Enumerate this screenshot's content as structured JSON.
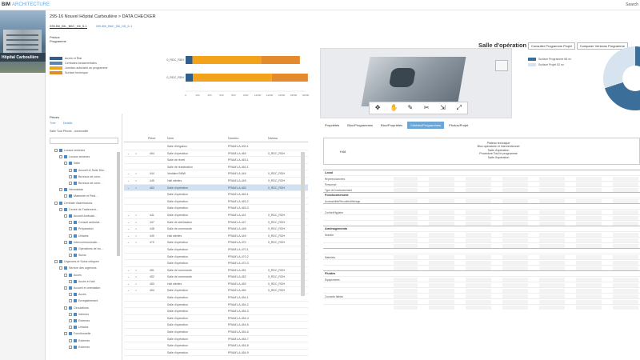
{
  "app": {
    "brand": "BIM",
    "brand_accent": "ARCHITECTURE",
    "search_label": "Search"
  },
  "sidebar": {
    "project_label": "Hôpital Carboulière"
  },
  "header": {
    "title": "295-16 Nouvel Hôpital Carboulière > DATA CHECKER",
    "tabs": [
      "295-B6_B6-_B6C_H6_5-1",
      "295-B6_B6C_B6_H6_5-1"
    ]
  },
  "filters": {
    "line1": "Préaux",
    "line2": "Programme"
  },
  "legend": [
    {
      "label": "Accès et Ëtat",
      "color": "#2f5f8a"
    },
    {
      "label": "Centrales fondamentales",
      "color": "#5a86b0"
    },
    {
      "label": "Jonction autorisée au programmé",
      "color": "#f3a21b"
    },
    {
      "label": "Surface technique",
      "color": "#e38b2c"
    }
  ],
  "bar_chart": {
    "categories": [
      "0_RDC_RDH",
      "0_RDC_RDH"
    ],
    "x_ticks": [
      "0",
      "200",
      "400",
      "600",
      "800",
      "1000",
      "12000",
      "14000",
      "16000",
      "18000",
      "20000"
    ]
  },
  "chart_data": {
    "type": "bar",
    "categories": [
      "0_RDC_RDH",
      "0_RDC_RDH"
    ],
    "series": [
      {
        "name": "Accès et Ëtat",
        "values": [
          1200,
          1300
        ]
      },
      {
        "name": "Jonction autorisée au programmé",
        "values": [
          12000,
          13800
        ]
      },
      {
        "name": "Surface technique",
        "values": [
          6800,
          6300
        ]
      }
    ],
    "xlim": [
      0,
      21000
    ],
    "orientation": "horizontal"
  },
  "viewer": {
    "tools": [
      "select-tool",
      "pan-tool",
      "measure-tool",
      "section-tool",
      "explode-tool",
      "fullscreen-tool"
    ]
  },
  "salle": {
    "title": "Salle d'opération",
    "tabs": [
      "Consulter Programme Projet",
      "Comparer Versions Programme"
    ],
    "legend": [
      {
        "label": "Surface Programme 68 m²",
        "color": "#3b6e98"
      },
      {
        "label": "Surface Projet 52 m²",
        "color": "#d7e3ee"
      }
    ]
  },
  "tree": {
    "title": "Pièces",
    "tabs": [
      "Tree",
      "Details"
    ],
    "note": "Salle Tout Pièces - commodité",
    "items": [
      {
        "label": "Locaux annexes",
        "indent": 1
      },
      {
        "label": "Locaux annexes",
        "indent": 2
      },
      {
        "label": "Salle",
        "indent": 3
      },
      {
        "label": "Accueil et Suite Dec…",
        "indent": 4
      },
      {
        "label": "Bureaux de conn…",
        "indent": 4
      },
      {
        "label": "Bureaux de conn…",
        "indent": 4
      },
      {
        "label": "Hémostase",
        "indent": 2
      },
      {
        "label": "Maternité et Pédi…",
        "indent": 3
      },
      {
        "label": "Centrale d'admissions",
        "indent": 1
      },
      {
        "label": "Centre de Traitement…",
        "indent": 2
      },
      {
        "label": "Accueil Ambulat…",
        "indent": 3
      },
      {
        "label": "Consult ambulat…",
        "indent": 4
      },
      {
        "label": "Préparation",
        "indent": 4
      },
      {
        "label": "Urbains",
        "indent": 4
      },
      {
        "label": "Intercommunicatio…",
        "indent": 3
      },
      {
        "label": "Opérations de ba…",
        "indent": 4
      },
      {
        "label": "Suivis",
        "indent": 4
      },
      {
        "label": "Urgences et Soins critiques",
        "indent": 1
      },
      {
        "label": "Service des urgences",
        "indent": 2
      },
      {
        "label": "Accès",
        "indent": 3
      },
      {
        "label": "Accès et hall",
        "indent": 4
      },
      {
        "label": "Accueil et orientation",
        "indent": 3
      },
      {
        "label": "Accès",
        "indent": 4
      },
      {
        "label": "Enregistrement",
        "indent": 4
      },
      {
        "label": "Circulations",
        "indent": 3
      },
      {
        "label": "Internes",
        "indent": 4
      },
      {
        "label": "Externes",
        "indent": 4
      },
      {
        "label": "Urbains",
        "indent": 4
      },
      {
        "label": "Fonctionnelle",
        "indent": 3
      },
      {
        "label": "Externes",
        "indent": 4
      },
      {
        "label": "Externes",
        "indent": 4
      }
    ]
  },
  "grid": {
    "columns": [
      "Pièce",
      "Nom",
      "Numéro",
      "Niveau"
    ],
    "rows": [
      {
        "num": "",
        "name": "Salle d'irrigation",
        "code": "PRAM1-A-400-1",
        "level": ""
      },
      {
        "num": "464",
        "name": "Salle d'opération",
        "code": "PRAM1-A-464",
        "level": "0_RDC_RDH"
      },
      {
        "num": "",
        "name": "Salle de réveil",
        "code": "PRAM1-A-463-1",
        "level": ""
      },
      {
        "num": "",
        "name": "Salle de réanimation",
        "code": "PRAM1-A-462-1",
        "level": ""
      },
      {
        "num": "444",
        "name": "Vestiaire BMW",
        "code": "PRAM1-A-444",
        "level": "0_RDC_RDH"
      },
      {
        "num": "445",
        "name": "Hall stériles",
        "code": "PRAM1-A-445",
        "level": "0_RDC_RDH"
      },
      {
        "num": "463",
        "name": "Salle d'opération",
        "code": "PRAM1-A-463",
        "level": "0_RDC_RDH"
      },
      {
        "num": "",
        "name": "Salle d'opération",
        "code": "PRAM1-A-463-1",
        "level": ""
      },
      {
        "num": "",
        "name": "Salle d'opération",
        "code": "PRAM1-A-463-2",
        "level": ""
      },
      {
        "num": "",
        "name": "Salle d'opération",
        "code": "PRAM1-A-463-3",
        "level": ""
      },
      {
        "num": "441",
        "name": "Salle d'opération",
        "code": "PRAM1-A-441",
        "level": "0_RDC_RDH"
      },
      {
        "num": "447",
        "name": "Salle de stérilisation",
        "code": "PRAM1-A-447",
        "level": "0_RDC_RDH"
      },
      {
        "num": "448",
        "name": "Salle de commande",
        "code": "PRAM1-A-448",
        "level": "0_RDC_RDH"
      },
      {
        "num": "449",
        "name": "Hall stériles",
        "code": "PRAM1-A-449",
        "level": "0_RDC_RDH"
      },
      {
        "num": "470",
        "name": "Salle d'opération",
        "code": "PRAM1-A-470",
        "level": "0_RDC_RDH"
      },
      {
        "num": "",
        "name": "Salle d'opération",
        "code": "PRAM1-A-470-1",
        "level": ""
      },
      {
        "num": "",
        "name": "Salle d'opération",
        "code": "PRAM1-A-470-2",
        "level": ""
      },
      {
        "num": "",
        "name": "Salle d'opération",
        "code": "PRAM1-A-470-3",
        "level": ""
      },
      {
        "num": "451",
        "name": "Salle de commande",
        "code": "PRAM1-A-451",
        "level": "0_RDC_RDH"
      },
      {
        "num": "452",
        "name": "Salle de commande",
        "code": "PRAM1-A-452",
        "level": "0_RDC_RDH"
      },
      {
        "num": "453",
        "name": "Hall stériles",
        "code": "PRAM1-A-453",
        "level": "0_RDC_RDH"
      },
      {
        "num": "454",
        "name": "Salle d'opération",
        "code": "PRAM1-A-454",
        "level": "0_RDC_RDH"
      },
      {
        "num": "",
        "name": "Salle d'opération",
        "code": "PRAM1-A-454-1",
        "level": ""
      },
      {
        "num": "",
        "name": "Salle d'opération",
        "code": "PRAM1-A-454-2",
        "level": ""
      },
      {
        "num": "",
        "name": "Salle d'opération",
        "code": "PRAM1-A-454-3",
        "level": ""
      },
      {
        "num": "",
        "name": "Salle d'opération",
        "code": "PRAM1-A-454-4",
        "level": ""
      },
      {
        "num": "",
        "name": "Salle d'opération",
        "code": "PRAM1-A-454-5",
        "level": ""
      },
      {
        "num": "",
        "name": "Salle d'opération",
        "code": "PRAM1-A-454-6",
        "level": ""
      },
      {
        "num": "",
        "name": "Salle d'opération",
        "code": "PRAM1-A-454-7",
        "level": ""
      },
      {
        "num": "",
        "name": "Salle d'opération",
        "code": "PRAM1-A-454-8",
        "level": ""
      },
      {
        "num": "",
        "name": "Salle d'opération",
        "code": "PRAM1-A-454-9",
        "level": ""
      }
    ],
    "selected_index": 6
  },
  "detail": {
    "tabs": [
      "Propriétés",
      "Bloc/Programmes",
      "Bloc/Propriétés",
      "Critères/Programmes",
      "Photos/Projet"
    ],
    "active_tab": 3,
    "code": "H48",
    "lines": [
      "Plateau technique",
      "Bloc opératoire et Interventionnel",
      "Salle d'opération",
      "Procédure Tout le programme",
      "Salle d'opération"
    ],
    "sections": [
      {
        "title": "Local",
        "rows": [
          "Repères/données",
          "Personnel",
          "Type de fonctionnement"
        ]
      },
      {
        "title": "Fonctionnement",
        "rows": [
          "Accessibilité/Sécurité/Affichage"
        ]
      },
      {
        "title": "",
        "rows": [
          "Confort/Hygiène",
          "",
          ""
        ]
      },
      {
        "title": "Aménagements",
        "rows": [
          "Mobilier",
          "",
          ""
        ]
      },
      {
        "title": "",
        "rows": [
          "Matériels",
          "",
          ""
        ]
      },
      {
        "title": "Fluides",
        "rows": [
          "Équipements",
          "",
          "",
          "Courants faibles",
          "",
          ""
        ]
      }
    ]
  }
}
